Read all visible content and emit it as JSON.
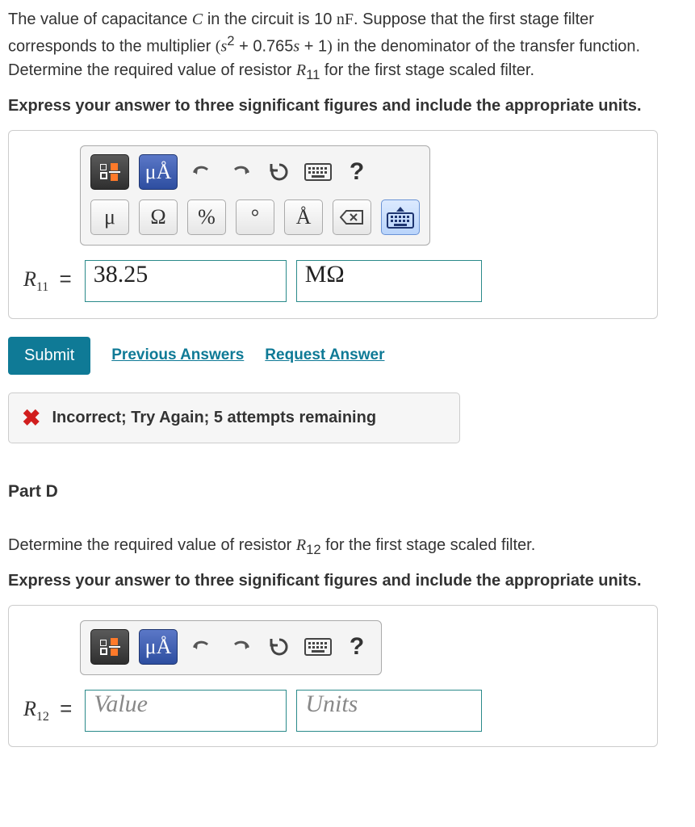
{
  "partC": {
    "problem_html": "The value of capacitance <span class='math-i'>C</span> in the circuit is 10 <span class='math-r'>nF</span>. Suppose that the first stage filter corresponds to the multiplier <span class='math-r'>(</span><span class='math-i'>s</span><sup>2</sup> + 0.765<span class='math-i'>s</span> + 1<span class='math-r'>)</span> in the denominator of the transfer function. Determine the required value of resistor <span class='math-i'>R</span><sub>11</sub> for the first stage scaled filter.",
    "instruction": "Express your answer to three significant figures and include the appropriate units.",
    "label_html": "<span class='math-i'>R</span><sub>11</sub><span class='eq'> = </span>",
    "value": "38.25",
    "unit": "MΩ"
  },
  "toolbar": {
    "units_btn": "μÅ",
    "help": "?",
    "row2": {
      "mu": "μ",
      "omega": "Ω",
      "percent": "%",
      "degree": "°",
      "angstrom": "Å"
    }
  },
  "actions": {
    "submit": "Submit",
    "previous": "Previous Answers",
    "request": "Request Answer"
  },
  "feedback": {
    "text": "Incorrect; Try Again; 5 attempts remaining"
  },
  "partD": {
    "label": "Part D",
    "problem_html": "Determine the required value of resistor <span class='math-i'>R</span><sub>12</sub> for the first stage scaled filter.",
    "instruction": "Express your answer to three significant figures and include the appropriate units.",
    "label_html": "<span class='math-i'>R</span><sub>12</sub><span class='eq'> = </span>",
    "value_placeholder": "Value",
    "unit_placeholder": "Units"
  }
}
